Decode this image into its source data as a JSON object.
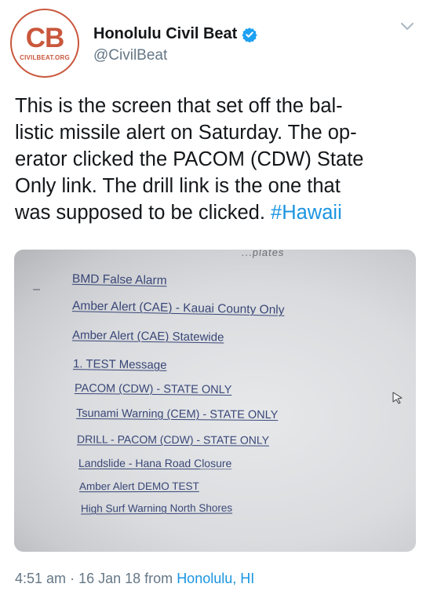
{
  "author": {
    "avatar_mark": "CB",
    "avatar_site": "CIVILBEAT.ORG",
    "display_name": "Honolulu Civil Beat",
    "handle": "@CivilBeat",
    "verified_icon": "verified-badge-icon",
    "brand_color": "#c9573c"
  },
  "tweet": {
    "text": "This is the screen that set off the bal-listic missile alert on Saturday. The op-erator clicked the PACOM (CDW) State Only link. The drill link is the one that was supposed to be clicked.",
    "text_lines": [
      "This is the screen that set off the bal-",
      "listic missile alert on Saturday. The op-",
      "erator clicked the PACOM (CDW) State",
      "Only link. The drill link is the one that",
      "was supposed to be clicked."
    ],
    "hashtag": "#Hawaii",
    "hashtag_color": "#1b95e0"
  },
  "photo": {
    "header_fragment": "...plates",
    "links": [
      "BMD False Alarm",
      "Amber Alert (CAE) - Kauai County Only",
      "Amber Alert (CAE) Statewide",
      "1. TEST Message",
      "PACOM (CDW) - STATE ONLY",
      "Tsunami Warning (CEM) - STATE ONLY",
      "DRILL - PACOM (CDW) - STATE ONLY",
      "Landslide - Hana Road Closure",
      "Amber Alert DEMO TEST",
      "High Surf Warning North Shores"
    ],
    "cursor_icon": "mouse-pointer-icon"
  },
  "footer": {
    "time": "4:51 am",
    "separator": "·",
    "date": "16 Jan 18",
    "from_label": "from",
    "location": "Honolulu, HI"
  },
  "menu": {
    "icon": "chevron-down-icon"
  }
}
